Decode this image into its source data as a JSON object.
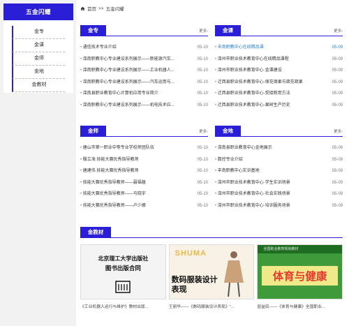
{
  "sidebar": {
    "title": "五金闪耀",
    "items": [
      {
        "label": "金专"
      },
      {
        "label": "金课"
      },
      {
        "label": "金师"
      },
      {
        "label": "金地"
      },
      {
        "label": "金教材"
      }
    ]
  },
  "breadcrumb": {
    "home": "首页",
    "separator": ">>",
    "current": "五金闪耀"
  },
  "more_label": "更多›",
  "panels": {
    "jinzhuan": {
      "title": "金专",
      "items": [
        {
          "title": "通信技术专业介绍",
          "date": "05-10"
        },
        {
          "title": "滦南职教中心专业建设系列展示——新能源汽车...",
          "date": "05-10"
        },
        {
          "title": "滦南职教中心专业建设系列展示——工业机器人...",
          "date": "05-10"
        },
        {
          "title": "滦南职教中心专业建设系列展示——汽车运用与...",
          "date": "05-10"
        },
        {
          "title": "滦南县职业教育中心计算机应用专业简介",
          "date": "05-10"
        },
        {
          "title": "滦南职教中心专业建设系列展示——机电技术应...",
          "date": "05-10"
        }
      ]
    },
    "jinke": {
      "title": "金课",
      "items": [
        {
          "title": "丰南职教中心在线精品课",
          "date": "05-09",
          "active": true
        },
        {
          "title": "滦州市职业技术教育中心在线精品课程",
          "date": "05-09"
        },
        {
          "title": "滦州市职业技术教育中心·金课建设",
          "date": "05-09"
        },
        {
          "title": "迁西县职业技术教育中心-保花保果与疏花疏果",
          "date": "05-09"
        },
        {
          "title": "迁西县职业技术教育中心-受接新用方法",
          "date": "05-09"
        },
        {
          "title": "迁西县职业技术教育中心-果树生产历史",
          "date": "05-09"
        }
      ]
    },
    "jinshi": {
      "title": "金师",
      "items": [
        {
          "title": "唐山市第一职业中等专业学校师团队伍",
          "date": "05-10"
        },
        {
          "title": "殷立海 技能大赛优秀指导教师",
          "date": "05-10"
        },
        {
          "title": "唐建伟 技能大赛优秀指导教师",
          "date": "05-10"
        },
        {
          "title": "技能大赛优秀指导教师——聂福蕴",
          "date": "05-10"
        },
        {
          "title": "技能大赛优秀指导教师——马晓宇",
          "date": "05-10"
        },
        {
          "title": "技能大赛优秀指导教师——卢少娜",
          "date": "05-10"
        }
      ]
    },
    "jindi": {
      "title": "金地",
      "items": [
        {
          "title": "滦南县职业教育中心金地展示",
          "date": "05-09"
        },
        {
          "title": "数控专业介绍",
          "date": "05-09"
        },
        {
          "title": "丰南职教中心实训基地",
          "date": "05-09"
        },
        {
          "title": "滦州市职业技术教育中心·学生实训场景",
          "date": "05-09"
        },
        {
          "title": "滦州市职业技术教育中心·社会实践场景",
          "date": "05-09"
        },
        {
          "title": "滦州市职业技术教育中心·培训服务场景",
          "date": "05-09"
        }
      ]
    }
  },
  "books": {
    "title": "金教材",
    "items": [
      {
        "cover_line1": "北京理工大学出版社",
        "cover_line2": "图书出版合同",
        "caption": "《工业机器人运行与维护》教材出版..."
      },
      {
        "cover_line1": "SHUMA",
        "cover_line2": "数码服装设计表现",
        "caption": "王丽华——《数码服装设计表现》\"..."
      },
      {
        "cover_line1": "全国职业教育规划教材",
        "cover_line2": "体育与健康",
        "caption": "屈益民——《体育与健康》全国职业..."
      }
    ]
  },
  "colors": {
    "accent": "#2a1fd6",
    "highlight": "#2a7fd6"
  }
}
